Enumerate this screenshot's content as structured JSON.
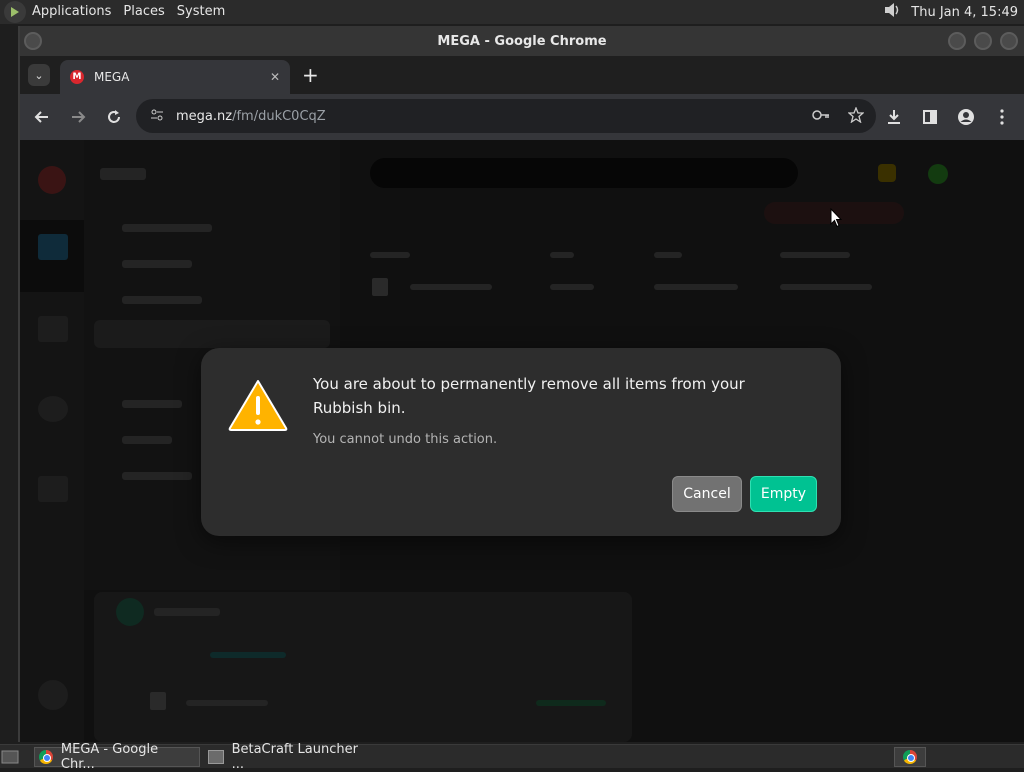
{
  "top_panel": {
    "menus": [
      "Applications",
      "Places",
      "System"
    ],
    "clock": "Thu Jan  4, 15:49"
  },
  "window": {
    "title": "MEGA - Google Chrome"
  },
  "tab": {
    "favicon_letter": "M",
    "label": "MEGA",
    "close": "✕",
    "new_tab": "+"
  },
  "omnibox": {
    "host": "mega.nz",
    "path": "/fm/dukC0CqZ"
  },
  "dialog": {
    "title": "You are about to permanently remove all items from your Rubbish bin.",
    "subtitle": "You cannot undo this action.",
    "cancel_label": "Cancel",
    "confirm_label": "Empty"
  },
  "taskbar": {
    "items": [
      "MEGA - Google Chr...",
      "BetaCraft Launcher ..."
    ]
  },
  "colors": {
    "accent_green": "#00c292",
    "warning_yellow": "#ffb300",
    "mega_red": "#d9272e"
  }
}
